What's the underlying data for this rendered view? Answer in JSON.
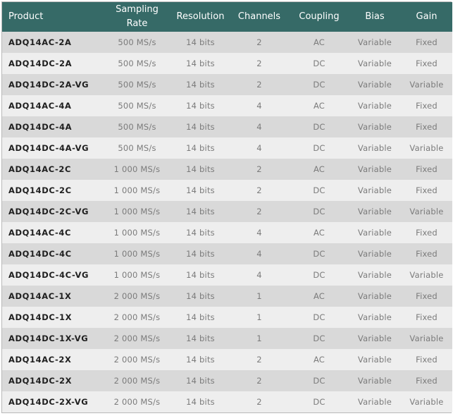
{
  "headers": [
    "Product",
    "Sampling Rate",
    "Resolution",
    "Channels",
    "Coupling",
    "Bias",
    "Gain"
  ],
  "rows": [
    [
      "ADQ14AC-2A",
      "500 MS/s",
      "14 bits",
      "2",
      "AC",
      "Variable",
      "Fixed"
    ],
    [
      "ADQ14DC-2A",
      "500 MS/s",
      "14 bits",
      "2",
      "DC",
      "Variable",
      "Fixed"
    ],
    [
      "ADQ14DC-2A-VG",
      "500 MS/s",
      "14 bits",
      "2",
      "DC",
      "Variable",
      "Variable"
    ],
    [
      "ADQ14AC-4A",
      "500 MS/s",
      "14 bits",
      "4",
      "AC",
      "Variable",
      "Fixed"
    ],
    [
      "ADQ14DC-4A",
      "500 MS/s",
      "14 bits",
      "4",
      "DC",
      "Variable",
      "Fixed"
    ],
    [
      "ADQ14DC-4A-VG",
      "500 MS/s",
      "14 bits",
      "4",
      "DC",
      "Variable",
      "Variable"
    ],
    [
      "ADQ14AC-2C",
      "1 000 MS/s",
      "14 bits",
      "2",
      "AC",
      "Variable",
      "Fixed"
    ],
    [
      "ADQ14DC-2C",
      "1 000 MS/s",
      "14 bits",
      "2",
      "DC",
      "Variable",
      "Fixed"
    ],
    [
      "ADQ14DC-2C-VG",
      "1 000 MS/s",
      "14 bits",
      "2",
      "DC",
      "Variable",
      "Variable"
    ],
    [
      "ADQ14AC-4C",
      "1 000 MS/s",
      "14 bits",
      "4",
      "AC",
      "Variable",
      "Fixed"
    ],
    [
      "ADQ14DC-4C",
      "1 000 MS/s",
      "14 bits",
      "4",
      "DC",
      "Variable",
      "Fixed"
    ],
    [
      "ADQ14DC-4C-VG",
      "1 000 MS/s",
      "14 bits",
      "4",
      "DC",
      "Variable",
      "Variable"
    ],
    [
      "ADQ14AC-1X",
      "2 000 MS/s",
      "14 bits",
      "1",
      "AC",
      "Variable",
      "Fixed"
    ],
    [
      "ADQ14DC-1X",
      "2 000 MS/s",
      "14 bits",
      "1",
      "DC",
      "Variable",
      "Fixed"
    ],
    [
      "ADQ14DC-1X-VG",
      "2 000 MS/s",
      "14 bits",
      "1",
      "DC",
      "Variable",
      "Variable"
    ],
    [
      "ADQ14AC-2X",
      "2 000 MS/s",
      "14 bits",
      "2",
      "AC",
      "Variable",
      "Fixed"
    ],
    [
      "ADQ14DC-2X",
      "2 000 MS/s",
      "14 bits",
      "2",
      "DC",
      "Variable",
      "Fixed"
    ],
    [
      "ADQ14DC-2X-VG",
      "2 000 MS/s",
      "14 bits",
      "2",
      "DC",
      "Variable",
      "Variable"
    ]
  ],
  "colors": {
    "header_bg": "#366a67",
    "header_text": "#ffffff",
    "row_odd": "#d9d9d9",
    "row_even": "#eeeeee",
    "product_text": "#1f1f1f",
    "cell_text": "#7b7b7b"
  }
}
